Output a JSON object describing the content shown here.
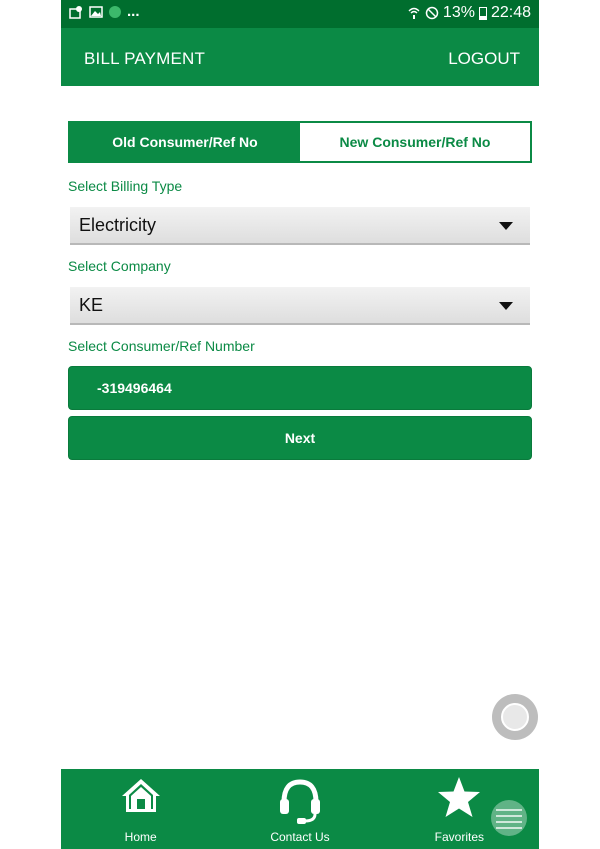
{
  "status_bar": {
    "more": "...",
    "battery": "13%",
    "time": "22:48"
  },
  "header": {
    "title": "BILL PAYMENT",
    "logout_label": "LOGOUT"
  },
  "tabs": [
    {
      "label": "Old Consumer/Ref  No",
      "active": true
    },
    {
      "label": "New Consumer/Ref No",
      "active": false
    }
  ],
  "form": {
    "billing_type_label": "Select Billing Type",
    "billing_type_value": "Electricity",
    "company_label": "Select Company",
    "company_value": "KE",
    "consumer_label": "Select Consumer/Ref Number",
    "consumer_value": "-319496464",
    "next_label": "Next"
  },
  "bottom_nav": {
    "items": [
      {
        "label": "Home",
        "icon": "home-icon"
      },
      {
        "label": "Contact Us",
        "icon": "headset-icon"
      },
      {
        "label": "Favorites",
        "icon": "star-icon"
      }
    ]
  },
  "colors": {
    "primary": "#0b8a45",
    "status_bar": "#006e2e"
  }
}
